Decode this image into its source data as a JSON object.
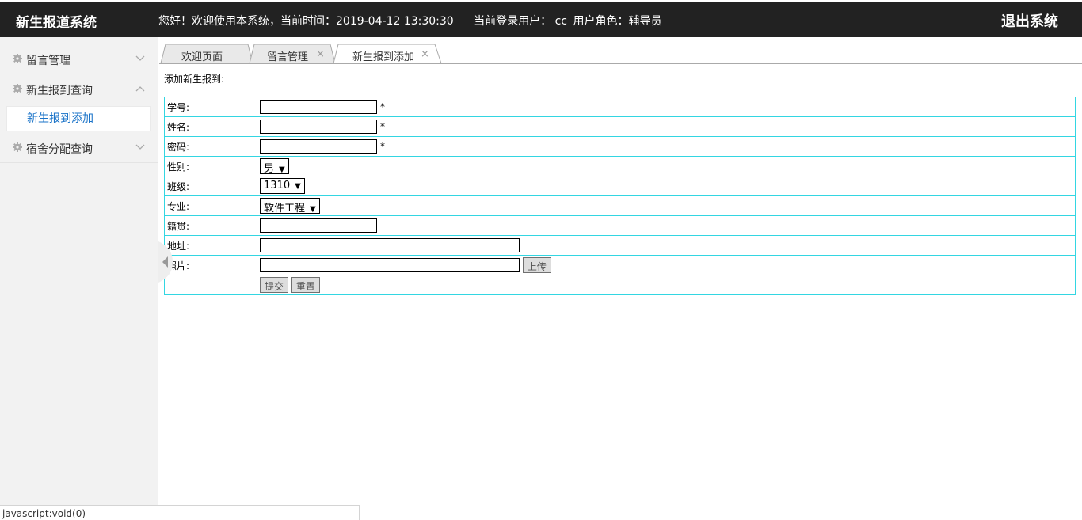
{
  "header": {
    "brand": "新生报道系统",
    "greeting": "您好！欢迎使用本系统，当前时间：2019-04-12 13:30:30",
    "user_label": "当前登录用户： cc",
    "role_label": "用户角色：辅导员",
    "logout": "退出系统"
  },
  "sidebar": {
    "menus": [
      {
        "label": "留言管理",
        "expanded": false
      },
      {
        "label": "新生报到查询",
        "expanded": true,
        "items": [
          {
            "label": "新生报到添加"
          }
        ]
      },
      {
        "label": "宿舍分配查询",
        "expanded": false
      }
    ]
  },
  "tabs": [
    {
      "label": "欢迎页面",
      "closable": false,
      "active": false
    },
    {
      "label": "留言管理",
      "closable": true,
      "active": false
    },
    {
      "label": "新生报到添加",
      "closable": true,
      "active": true
    }
  ],
  "close_glyph": "×",
  "form": {
    "title": "添加新生报到:",
    "required_mark": "*",
    "labels": {
      "student_id": "学号:",
      "name": "姓名:",
      "password": "密码:",
      "gender": "性别:",
      "class": "班级:",
      "major": "专业:",
      "origin": "籍贯:",
      "address": "地址:",
      "photo": "照片:"
    },
    "values": {
      "student_id": "",
      "name": "",
      "password": "",
      "gender": "男",
      "class": "1310",
      "major": "软件工程",
      "origin": "",
      "address": "",
      "photo": ""
    },
    "upload_button": "上传",
    "submit_button": "提交",
    "reset_button": "重置"
  },
  "status_bar": "javascript:void(0)",
  "colors": {
    "header_bg": "#222222",
    "sidebar_bg": "#f2f2f2",
    "submenu_link": "#1a73c8",
    "table_border": "#33d6e2"
  }
}
